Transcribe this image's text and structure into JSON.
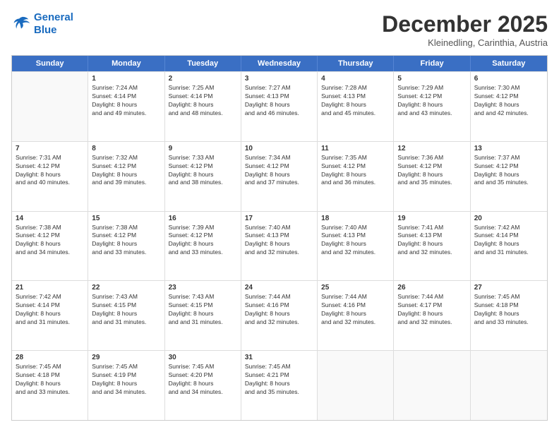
{
  "logo": {
    "line1": "General",
    "line2": "Blue"
  },
  "header": {
    "month": "December 2025",
    "location": "Kleinedling, Carinthia, Austria"
  },
  "weekdays": [
    "Sunday",
    "Monday",
    "Tuesday",
    "Wednesday",
    "Thursday",
    "Friday",
    "Saturday"
  ],
  "rows": [
    [
      {
        "day": "",
        "sunrise": "",
        "sunset": "",
        "daylight": ""
      },
      {
        "day": "1",
        "sunrise": "Sunrise: 7:24 AM",
        "sunset": "Sunset: 4:14 PM",
        "daylight": "Daylight: 8 hours and 49 minutes."
      },
      {
        "day": "2",
        "sunrise": "Sunrise: 7:25 AM",
        "sunset": "Sunset: 4:14 PM",
        "daylight": "Daylight: 8 hours and 48 minutes."
      },
      {
        "day": "3",
        "sunrise": "Sunrise: 7:27 AM",
        "sunset": "Sunset: 4:13 PM",
        "daylight": "Daylight: 8 hours and 46 minutes."
      },
      {
        "day": "4",
        "sunrise": "Sunrise: 7:28 AM",
        "sunset": "Sunset: 4:13 PM",
        "daylight": "Daylight: 8 hours and 45 minutes."
      },
      {
        "day": "5",
        "sunrise": "Sunrise: 7:29 AM",
        "sunset": "Sunset: 4:12 PM",
        "daylight": "Daylight: 8 hours and 43 minutes."
      },
      {
        "day": "6",
        "sunrise": "Sunrise: 7:30 AM",
        "sunset": "Sunset: 4:12 PM",
        "daylight": "Daylight: 8 hours and 42 minutes."
      }
    ],
    [
      {
        "day": "7",
        "sunrise": "Sunrise: 7:31 AM",
        "sunset": "Sunset: 4:12 PM",
        "daylight": "Daylight: 8 hours and 40 minutes."
      },
      {
        "day": "8",
        "sunrise": "Sunrise: 7:32 AM",
        "sunset": "Sunset: 4:12 PM",
        "daylight": "Daylight: 8 hours and 39 minutes."
      },
      {
        "day": "9",
        "sunrise": "Sunrise: 7:33 AM",
        "sunset": "Sunset: 4:12 PM",
        "daylight": "Daylight: 8 hours and 38 minutes."
      },
      {
        "day": "10",
        "sunrise": "Sunrise: 7:34 AM",
        "sunset": "Sunset: 4:12 PM",
        "daylight": "Daylight: 8 hours and 37 minutes."
      },
      {
        "day": "11",
        "sunrise": "Sunrise: 7:35 AM",
        "sunset": "Sunset: 4:12 PM",
        "daylight": "Daylight: 8 hours and 36 minutes."
      },
      {
        "day": "12",
        "sunrise": "Sunrise: 7:36 AM",
        "sunset": "Sunset: 4:12 PM",
        "daylight": "Daylight: 8 hours and 35 minutes."
      },
      {
        "day": "13",
        "sunrise": "Sunrise: 7:37 AM",
        "sunset": "Sunset: 4:12 PM",
        "daylight": "Daylight: 8 hours and 35 minutes."
      }
    ],
    [
      {
        "day": "14",
        "sunrise": "Sunrise: 7:38 AM",
        "sunset": "Sunset: 4:12 PM",
        "daylight": "Daylight: 8 hours and 34 minutes."
      },
      {
        "day": "15",
        "sunrise": "Sunrise: 7:38 AM",
        "sunset": "Sunset: 4:12 PM",
        "daylight": "Daylight: 8 hours and 33 minutes."
      },
      {
        "day": "16",
        "sunrise": "Sunrise: 7:39 AM",
        "sunset": "Sunset: 4:12 PM",
        "daylight": "Daylight: 8 hours and 33 minutes."
      },
      {
        "day": "17",
        "sunrise": "Sunrise: 7:40 AM",
        "sunset": "Sunset: 4:13 PM",
        "daylight": "Daylight: 8 hours and 32 minutes."
      },
      {
        "day": "18",
        "sunrise": "Sunrise: 7:40 AM",
        "sunset": "Sunset: 4:13 PM",
        "daylight": "Daylight: 8 hours and 32 minutes."
      },
      {
        "day": "19",
        "sunrise": "Sunrise: 7:41 AM",
        "sunset": "Sunset: 4:13 PM",
        "daylight": "Daylight: 8 hours and 32 minutes."
      },
      {
        "day": "20",
        "sunrise": "Sunrise: 7:42 AM",
        "sunset": "Sunset: 4:14 PM",
        "daylight": "Daylight: 8 hours and 31 minutes."
      }
    ],
    [
      {
        "day": "21",
        "sunrise": "Sunrise: 7:42 AM",
        "sunset": "Sunset: 4:14 PM",
        "daylight": "Daylight: 8 hours and 31 minutes."
      },
      {
        "day": "22",
        "sunrise": "Sunrise: 7:43 AM",
        "sunset": "Sunset: 4:15 PM",
        "daylight": "Daylight: 8 hours and 31 minutes."
      },
      {
        "day": "23",
        "sunrise": "Sunrise: 7:43 AM",
        "sunset": "Sunset: 4:15 PM",
        "daylight": "Daylight: 8 hours and 31 minutes."
      },
      {
        "day": "24",
        "sunrise": "Sunrise: 7:44 AM",
        "sunset": "Sunset: 4:16 PM",
        "daylight": "Daylight: 8 hours and 32 minutes."
      },
      {
        "day": "25",
        "sunrise": "Sunrise: 7:44 AM",
        "sunset": "Sunset: 4:16 PM",
        "daylight": "Daylight: 8 hours and 32 minutes."
      },
      {
        "day": "26",
        "sunrise": "Sunrise: 7:44 AM",
        "sunset": "Sunset: 4:17 PM",
        "daylight": "Daylight: 8 hours and 32 minutes."
      },
      {
        "day": "27",
        "sunrise": "Sunrise: 7:45 AM",
        "sunset": "Sunset: 4:18 PM",
        "daylight": "Daylight: 8 hours and 33 minutes."
      }
    ],
    [
      {
        "day": "28",
        "sunrise": "Sunrise: 7:45 AM",
        "sunset": "Sunset: 4:18 PM",
        "daylight": "Daylight: 8 hours and 33 minutes."
      },
      {
        "day": "29",
        "sunrise": "Sunrise: 7:45 AM",
        "sunset": "Sunset: 4:19 PM",
        "daylight": "Daylight: 8 hours and 34 minutes."
      },
      {
        "day": "30",
        "sunrise": "Sunrise: 7:45 AM",
        "sunset": "Sunset: 4:20 PM",
        "daylight": "Daylight: 8 hours and 34 minutes."
      },
      {
        "day": "31",
        "sunrise": "Sunrise: 7:45 AM",
        "sunset": "Sunset: 4:21 PM",
        "daylight": "Daylight: 8 hours and 35 minutes."
      },
      {
        "day": "",
        "sunrise": "",
        "sunset": "",
        "daylight": ""
      },
      {
        "day": "",
        "sunrise": "",
        "sunset": "",
        "daylight": ""
      },
      {
        "day": "",
        "sunrise": "",
        "sunset": "",
        "daylight": ""
      }
    ]
  ]
}
